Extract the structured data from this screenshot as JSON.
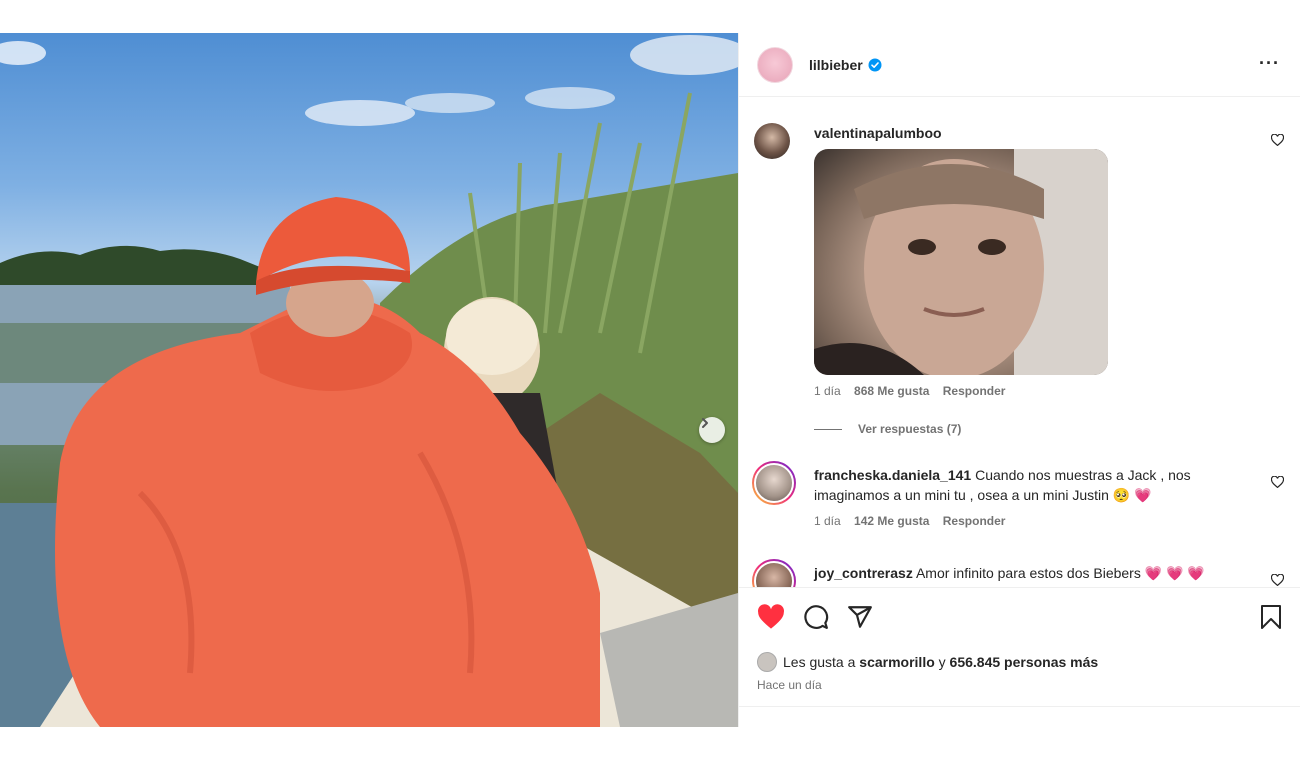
{
  "post": {
    "username": "lilbieber",
    "more_label": "···"
  },
  "comments": [
    {
      "username": "valentinapalumboo",
      "text": "",
      "time": "1 día",
      "likes": "868 Me gusta",
      "reply": "Responder",
      "view_replies": "Ver respuestas (7)"
    },
    {
      "username": "francheska.daniela_141",
      "text": "Cuando nos muestras a Jack , nos imaginamos a un mini tu , osea a un mini Justin 🥺 💗",
      "time": "1 día",
      "likes": "142 Me gusta",
      "reply": "Responder"
    },
    {
      "username": "joy_contrerasz",
      "text": "Amor infinito para estos dos Biebers 💗 💗 💗"
    }
  ],
  "likes_line": {
    "prefix": "Les gusta a",
    "user": "scarmorillo",
    "joiner": "y",
    "count": "656.845 personas más"
  },
  "timestamp": "Hace un día",
  "colors": {
    "like_red": "#ff3040",
    "verified_blue": "#0095f6",
    "meta_gray": "#737373"
  },
  "icons": [
    "heart-icon",
    "comment-icon",
    "share-icon",
    "bookmark-icon",
    "verified-icon",
    "chevron-right-icon"
  ]
}
